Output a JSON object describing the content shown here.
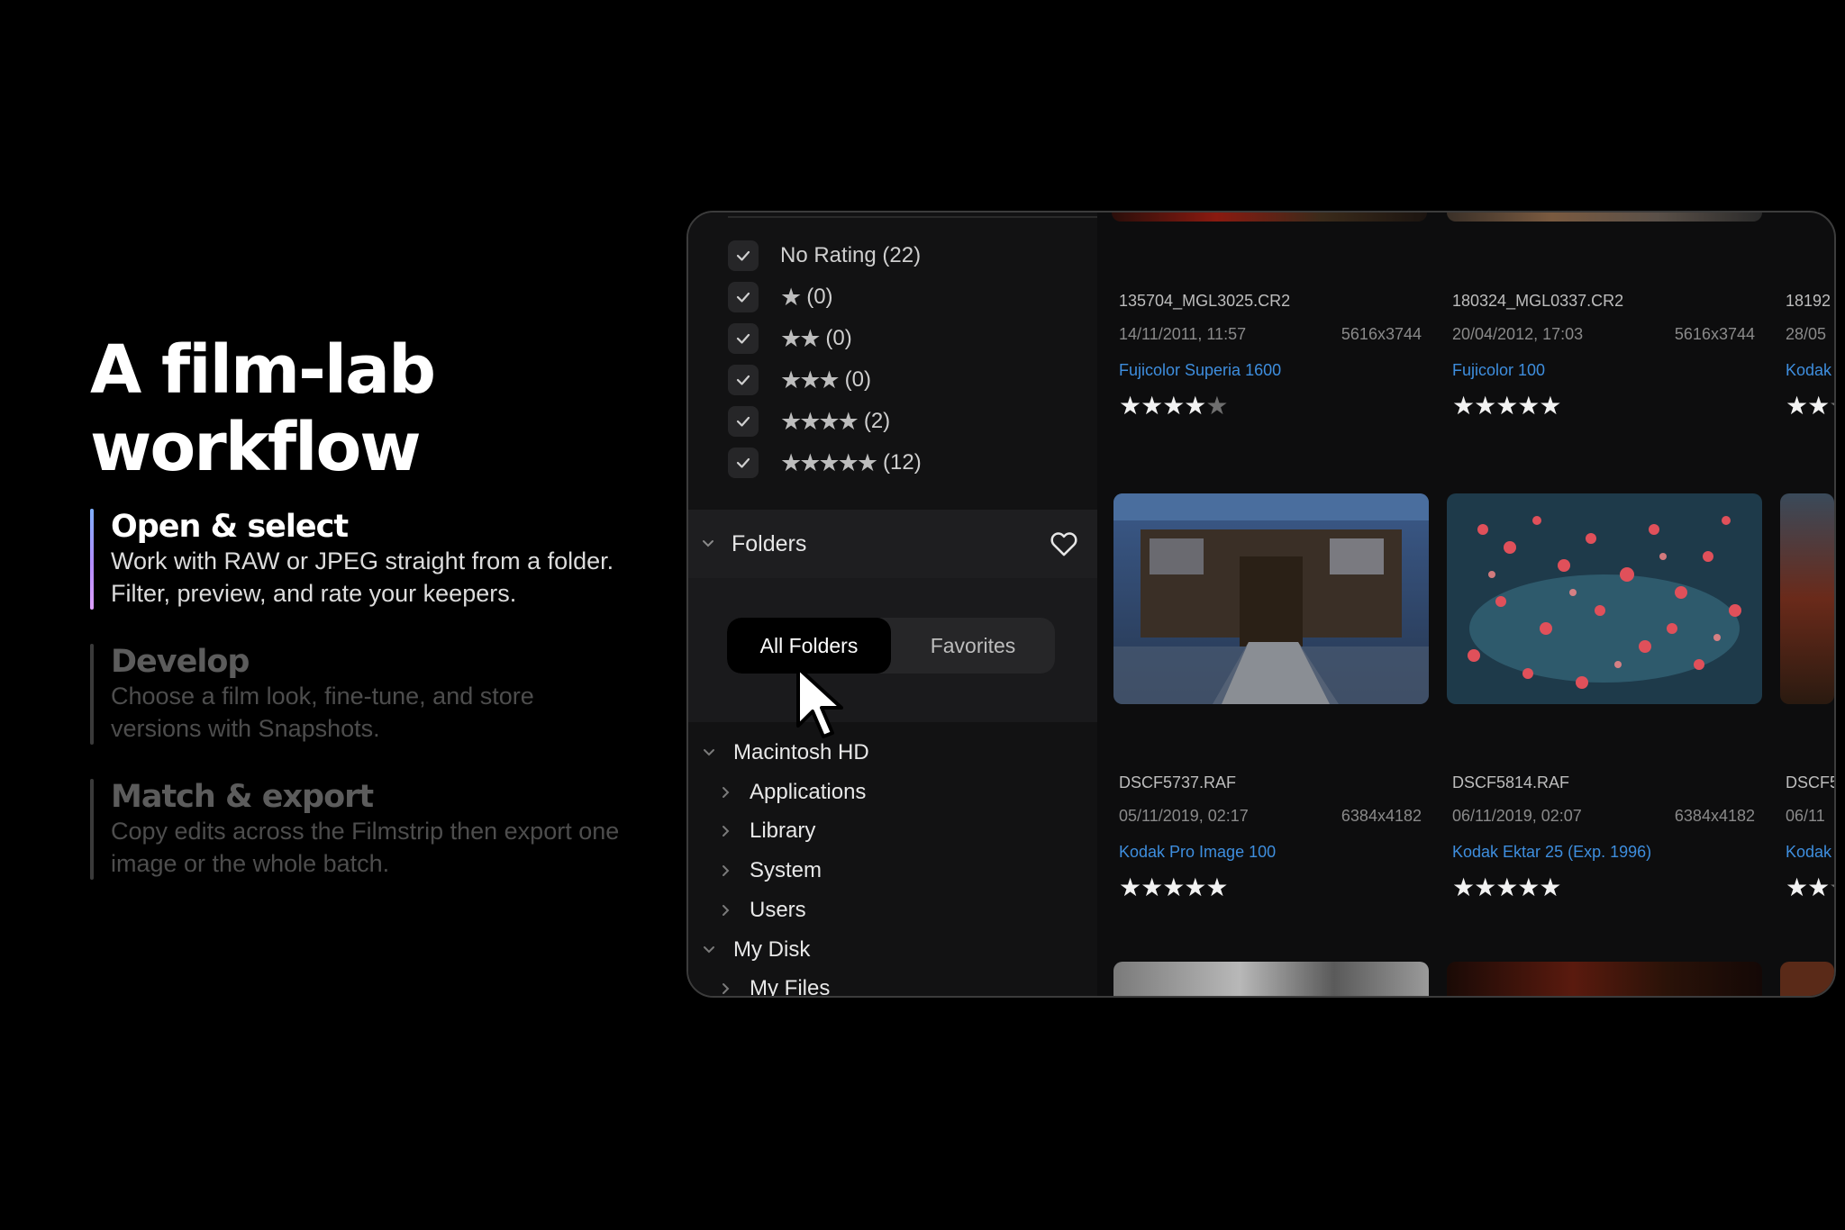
{
  "hero": {
    "title": "A film-lab\nworkflow"
  },
  "steps": [
    {
      "title": "Open & select",
      "desc": "Work with RAW or JPEG straight from a folder.\nFilter, preview, and rate your keepers.",
      "active": true
    },
    {
      "title": "Develop",
      "desc": "Choose a film look, fine-tune, and store\nversions with Snapshots.",
      "active": false
    },
    {
      "title": "Match & export",
      "desc": "Copy edits across the Filmstrip then export one\nimage or the whole batch.",
      "active": false
    }
  ],
  "ratings": [
    {
      "stars": "",
      "count": "No Rating (22)"
    },
    {
      "stars": "★",
      "count": "(0)"
    },
    {
      "stars": "★★",
      "count": "(0)"
    },
    {
      "stars": "★★★",
      "count": "(0)"
    },
    {
      "stars": "★★★★",
      "count": "(2)"
    },
    {
      "stars": "★★★★★",
      "count": "(12)"
    }
  ],
  "folders": {
    "label": "Folders",
    "tabs": {
      "all": "All Folders",
      "favorites": "Favorites"
    }
  },
  "tree": [
    {
      "label": "Macintosh HD",
      "level": 0,
      "expanded": true
    },
    {
      "label": "Applications",
      "level": 1,
      "expanded": false
    },
    {
      "label": "Library",
      "level": 1,
      "expanded": false
    },
    {
      "label": "System",
      "level": 1,
      "expanded": false
    },
    {
      "label": "Users",
      "level": 1,
      "expanded": false
    },
    {
      "label": "My Disk",
      "level": 0,
      "expanded": true
    },
    {
      "label": "My Files",
      "level": 1,
      "expanded": false
    }
  ],
  "photos_row1": [
    {
      "file": "135704_MGL3025.CR2",
      "date": "14/11/2011, 11:57",
      "size": "5616x3744",
      "film": "Fujicolor Superia 1600",
      "rating": 4
    },
    {
      "file": "180324_MGL0337.CR2",
      "date": "20/04/2012, 17:03",
      "size": "5616x3744",
      "film": "Fujicolor 100",
      "rating": 5
    },
    {
      "file": "18192",
      "date": "28/05",
      "size": "",
      "film": "Kodak",
      "rating": 2
    }
  ],
  "photos_row2": [
    {
      "file": "DSCF5737.RAF",
      "date": "05/11/2019, 02:17",
      "size": "6384x4182",
      "film": "Kodak Pro Image 100",
      "rating": 5
    },
    {
      "file": "DSCF5814.RAF",
      "date": "06/11/2019, 02:07",
      "size": "6384x4182",
      "film": "Kodak Ektar 25 (Exp. 1996)",
      "rating": 5
    },
    {
      "file": "DSCF5",
      "date": "06/11",
      "size": "",
      "film": "Kodak",
      "rating": 2
    }
  ],
  "colors": {
    "accent_link": "#3e8ede",
    "active_bar_gradient": [
      "#7fb0ff",
      "#b48cff",
      "#e0a0ff"
    ]
  }
}
